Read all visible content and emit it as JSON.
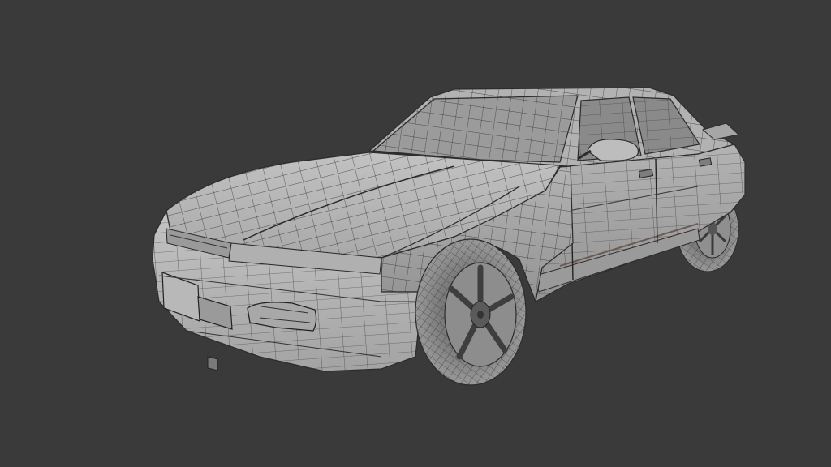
{
  "viewport": {
    "background": "#3a3a3a",
    "shading": "solid-wireframe",
    "subject": "sedan-car-3d-model"
  },
  "colors": {
    "surface_light": "#b9b9b9",
    "surface_mid": "#a5a5a5",
    "surface_dark": "#8c8c8c",
    "glass": "#8d8d8d",
    "tire": "#6f6f6f",
    "wire": "#2c2c2c"
  }
}
